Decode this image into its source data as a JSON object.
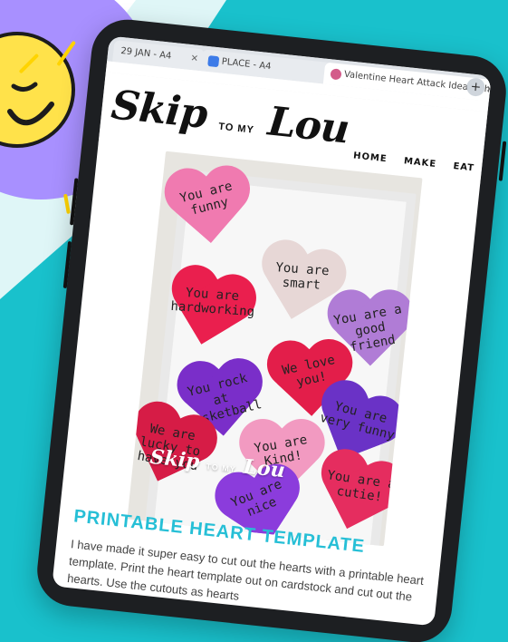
{
  "background": {
    "teal": "#19c1cc",
    "light": "#dff6f7",
    "sun_burst": "#a890ff",
    "sun_face": "#ffe24a"
  },
  "browser": {
    "tabs": [
      {
        "label": "29 JAN - A4",
        "active": false
      },
      {
        "label": "PLACE - A4",
        "active": false
      },
      {
        "label": "Valentine Heart Attack Idea with",
        "active": true
      }
    ],
    "close_glyph": "✕",
    "new_tab_glyph": "+"
  },
  "site": {
    "logo_main": "Skip",
    "logo_small": "TO MY",
    "logo_last": "Lou",
    "nav": [
      "HOME",
      "MAKE",
      "EAT"
    ]
  },
  "hearts": [
    {
      "text": "You are funny",
      "color": "#f07ab0"
    },
    {
      "text": "You are smart",
      "color": "#e7d7d6"
    },
    {
      "text": "You are a good friend",
      "color": "#b07cd6"
    },
    {
      "text": "You are hardworking",
      "color": "#ea1f4e"
    },
    {
      "text": "We love you!",
      "color": "#e31e4a"
    },
    {
      "text": "You rock at basketball",
      "color": "#7a2ec9"
    },
    {
      "text": "You are very funny",
      "color": "#6a32c6"
    },
    {
      "text": "We are lucky to have you",
      "color": "#d61c46"
    },
    {
      "text": "You are Kind!",
      "color": "#f29ac1"
    },
    {
      "text": "You are a cutie!",
      "color": "#e52d5f"
    },
    {
      "text": "You are nice",
      "color": "#8b3cdc"
    }
  ],
  "photo_overlay": {
    "logo_main": "Skip",
    "logo_small": "TO MY",
    "logo_last": "Lou"
  },
  "content": {
    "section_title": "PRINTABLE HEART TEMPLATE",
    "body": "I have made it super easy to cut out the hearts with a printable heart template. Print the heart template out on cardstock and cut out the hearts. Use the cutouts as hearts"
  }
}
